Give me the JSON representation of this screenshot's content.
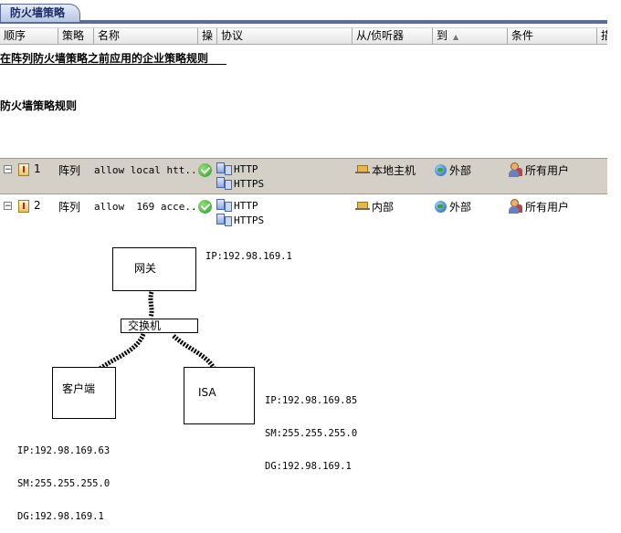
{
  "tab": {
    "label": "防火墙策略"
  },
  "columns": [
    "顺序",
    "策略",
    "名称",
    "操",
    "协议",
    "从/侦听器",
    "到",
    "条件",
    "描"
  ],
  "sections": {
    "enterprise": "在阵列防火墙策略之前应用的企业策略规则",
    "firewall": "防火墙策略规则"
  },
  "rules": [
    {
      "order": "1",
      "policy": "阵列",
      "name": "allow local htt...",
      "protocols": [
        "HTTP",
        "HTTPS"
      ],
      "from": "本地主机",
      "to": "外部",
      "condition": "所有用户",
      "selected": true
    },
    {
      "order": "2",
      "policy": "阵列",
      "name": "allow  169 acce...",
      "protocols": [
        "HTTP",
        "HTTPS"
      ],
      "from": "内部",
      "to": "外部",
      "condition": "所有用户",
      "selected": false
    }
  ],
  "diagram": {
    "gateway": {
      "label": "网关",
      "info": "IP:192.98.169.1"
    },
    "switch": {
      "label": "交换机"
    },
    "client": {
      "label": "客户端",
      "info": [
        "IP:192.98.169.63",
        "SM:255.255.255.0",
        "DG:192.98.169.1"
      ]
    },
    "isa": {
      "label": "ISA",
      "info": [
        "IP:192.98.169.85",
        "SM:255.255.255.0",
        "DG:192.98.169.1"
      ]
    }
  }
}
